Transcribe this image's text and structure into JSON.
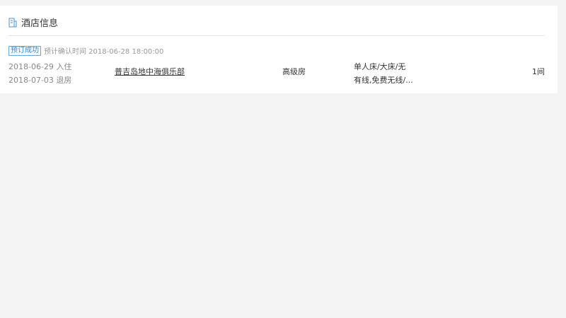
{
  "section": {
    "icon": "hotel-icon",
    "title": "酒店信息"
  },
  "status": {
    "badge": "预订成功",
    "confirm_text": "预计确认时间 2018-06-28 18:00:00"
  },
  "booking": {
    "check_in": "2018-06-29 入住",
    "check_out": "2018-07-03 退房",
    "hotel_name": "普吉岛地中海俱乐部",
    "room_type": "高级房",
    "room_detail_line1": "单人床/大床/无",
    "room_detail_line2": "有线,免费无线/...",
    "room_count": "1间"
  },
  "colors": {
    "badge_border": "#6aa7d8",
    "badge_text": "#3d8bd0",
    "background": "#f4f4f4",
    "card": "#ffffff"
  }
}
